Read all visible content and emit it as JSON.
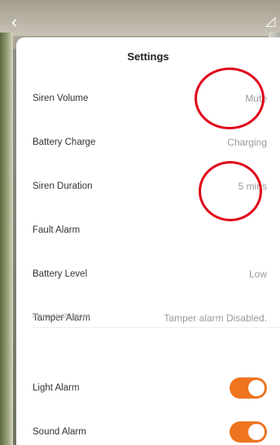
{
  "header": {
    "title": "Settings"
  },
  "settings": {
    "siren_volume": {
      "label": "Siren Volume",
      "value": "Mute"
    },
    "battery_charge": {
      "label": "Battery Charge",
      "value": "Charging"
    },
    "siren_duration": {
      "label": "Siren Duration",
      "value": "5 mins"
    },
    "fault_alarm": {
      "label": "Fault Alarm",
      "value": ""
    },
    "battery_level": {
      "label": "Battery Level",
      "value": "Low"
    },
    "tamper_alarm": {
      "label": "Tamper Alarm",
      "value": "Tamper alarm Disabled."
    }
  },
  "notifications": {
    "section_title": "Alarm Notifications",
    "light_alarm": {
      "label": "Light Alarm",
      "enabled": true
    },
    "sound_alarm": {
      "label": "Sound Alarm",
      "enabled": true
    }
  },
  "colors": {
    "toggle_on": "#ee7420",
    "annotation": "#e0001a"
  },
  "icons": {
    "back": "chevron-left-icon",
    "edit": "edit-icon"
  }
}
